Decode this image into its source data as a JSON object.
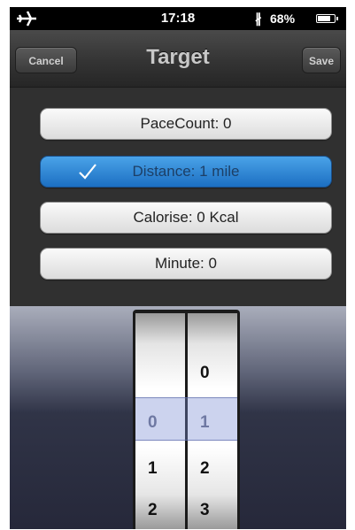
{
  "status_bar": {
    "time": "17:18",
    "battery_percent": "68%",
    "battery_level": 0.68,
    "icons": [
      "airplane-icon",
      "bluetooth-icon",
      "battery-icon"
    ]
  },
  "nav": {
    "title": "Target",
    "cancel_label": "Cancel",
    "save_label": "Save"
  },
  "options": [
    {
      "label": "PaceCount: 0",
      "selected": false
    },
    {
      "label": "Distance: 1 mile",
      "selected": true
    },
    {
      "label": "Calorise: 0 Kcal",
      "selected": false
    },
    {
      "label": "Minute: 0",
      "selected": false
    }
  ],
  "picker": {
    "wheel1": {
      "values": [
        "0",
        "1",
        "2"
      ],
      "selected": "0"
    },
    "wheel2": {
      "values": [
        "0",
        "1",
        "2",
        "3"
      ],
      "selected": "1"
    }
  },
  "colors": {
    "selected_accent": "#1c6fc2",
    "nav_bg": "#343434"
  }
}
